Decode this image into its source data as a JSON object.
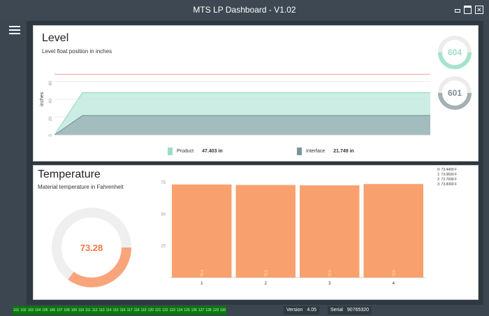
{
  "window": {
    "title": "MTS LP Dashboard - V1.02",
    "controls": [
      "minimize",
      "maximize",
      "close"
    ]
  },
  "sidebar": {
    "menu_icon": "hamburger-menu-icon"
  },
  "level": {
    "title": "Level",
    "subtitle": "Level float position in inches",
    "chart_data": {
      "type": "area",
      "ylabel": "inches",
      "ylim": [
        0,
        80
      ],
      "y_ticks": [
        "0",
        "20",
        "40",
        "60"
      ],
      "threshold": 68,
      "grid": true,
      "series": [
        {
          "name": "Product",
          "values": [
            0,
            47.403,
            47.403,
            47.403,
            47.403
          ],
          "color": "#bfe8dc"
        },
        {
          "name": "Interface",
          "values": [
            0,
            21.749,
            21.749,
            21.749,
            21.749
          ],
          "color": "#9fb7b9"
        }
      ]
    },
    "legend": [
      {
        "label": "Product",
        "value": "47.403 in",
        "color": "#9ddcc8"
      },
      {
        "label": "Interface",
        "value": "21.749 in",
        "color": "#7a969a"
      }
    ],
    "gauges": [
      {
        "value": "604",
        "fraction": 0.5,
        "color": "#a6e3cf",
        "text_color": "#9fdcc8"
      },
      {
        "value": "601",
        "fraction": 0.5,
        "color": "#a4b0b5",
        "text_color": "#7f8c93"
      }
    ]
  },
  "temperature": {
    "title": "Temperature",
    "subtitle": "Material temperature in Fahrenheit",
    "donut": {
      "value": "73.28",
      "fraction": 0.35,
      "color": "#f8a57c",
      "track": "#efefef"
    },
    "chart_data": {
      "type": "bar",
      "categories": [
        "1",
        "2",
        "3",
        "4"
      ],
      "values": [
        73.44,
        73.06,
        72.77,
        73.83
      ],
      "bar_labels": [
        "73.4",
        "73.1",
        "72.8",
        "73.8"
      ],
      "ylim": [
        0,
        80
      ],
      "y_ticks": [
        "25",
        "50",
        "75"
      ],
      "color": "#f9a16e"
    },
    "readings": [
      "0: 73.4400 F",
      "1: 73.0600 F",
      "2: 72.7699 F",
      "3: 73.8300 F"
    ]
  },
  "status": {
    "ids": [
      "101",
      "102",
      "103",
      "104",
      "105",
      "106",
      "107",
      "108",
      "109",
      "110",
      "111",
      "112",
      "113",
      "114",
      "115",
      "116",
      "117",
      "118",
      "119",
      "120",
      "121",
      "122",
      "123",
      "124",
      "125",
      "126",
      "127",
      "128",
      "129",
      "130"
    ],
    "version_label": "Version",
    "version": "4.05",
    "serial_label": "Serial",
    "serial": "90765320"
  }
}
